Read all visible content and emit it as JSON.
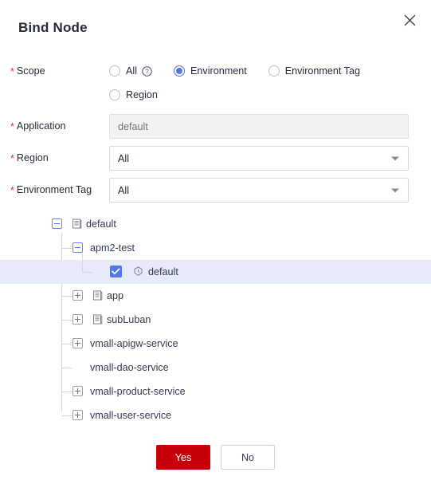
{
  "dialog": {
    "title": "Bind Node",
    "close_icon": "close-icon"
  },
  "form": {
    "scope": {
      "label": "Scope",
      "required_mark": "*",
      "options": [
        {
          "label": "All",
          "selected": false,
          "help_icon": "help-circle-icon"
        },
        {
          "label": "Environment",
          "selected": true
        },
        {
          "label": "Environment Tag",
          "selected": false
        },
        {
          "label": "Region",
          "selected": false
        }
      ]
    },
    "application": {
      "label": "Application",
      "required_mark": "*",
      "value": "",
      "placeholder": "default",
      "disabled": true
    },
    "region": {
      "label": "Region",
      "required_mark": "*",
      "value": "All",
      "caret_icon": "chevron-down-icon"
    },
    "environment_tag": {
      "label": "Environment Tag",
      "required_mark": "*",
      "value": "All",
      "caret_icon": "chevron-down-icon"
    }
  },
  "tree": {
    "nodes": [
      {
        "label": "default",
        "level": 0,
        "state": "expanded",
        "icon": "document-icon"
      },
      {
        "label": "apm2-test",
        "level": 1,
        "state": "expanded",
        "icon": "none"
      },
      {
        "label": "default",
        "level": 2,
        "state": "leaf",
        "icon": "hexagon-icon",
        "checked": true,
        "highlighted": true
      },
      {
        "label": "app",
        "level": 1,
        "state": "collapsed",
        "icon": "document-icon"
      },
      {
        "label": "subLuban",
        "level": 1,
        "state": "collapsed",
        "icon": "document-icon"
      },
      {
        "label": "vmall-apigw-service",
        "level": 1,
        "state": "collapsed",
        "icon": "none"
      },
      {
        "label": "vmall-dao-service",
        "level": 1,
        "state": "leaf",
        "icon": "none"
      },
      {
        "label": "vmall-product-service",
        "level": 1,
        "state": "collapsed",
        "icon": "none"
      },
      {
        "label": "vmall-user-service",
        "level": 1,
        "state": "collapsed",
        "icon": "none"
      }
    ]
  },
  "footer": {
    "confirm_label": "Yes",
    "cancel_label": "No"
  },
  "colors": {
    "accent_blue": "#5576ea",
    "primary_red": "#c7000b",
    "required_red": "#e62b2b",
    "row_highlight": "#e7ebf9",
    "text": "#252b3a"
  }
}
